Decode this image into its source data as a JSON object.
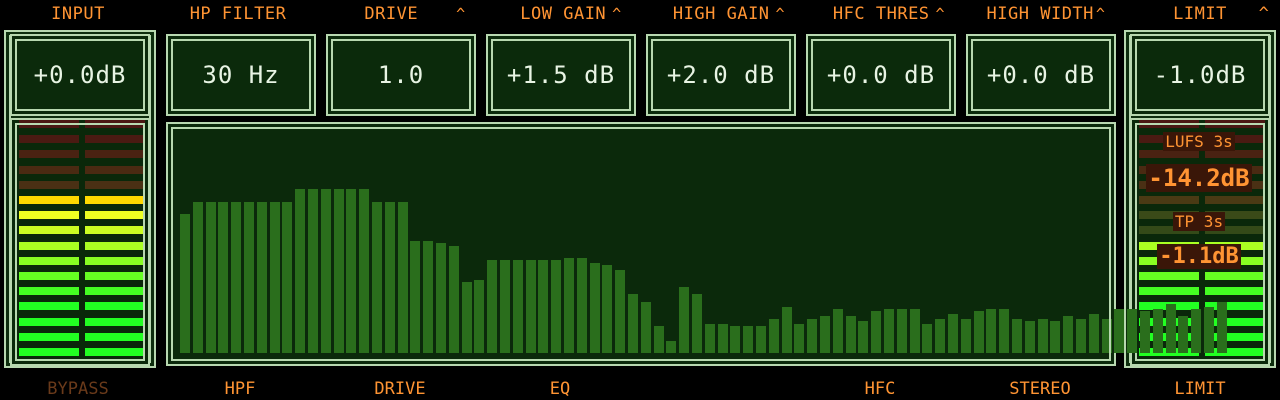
{
  "top_labels": {
    "input": "INPUT",
    "hp_filter": "HP FILTER",
    "drive": "DRIVE",
    "low_gain": "LOW GAIN",
    "high_gain": "HIGH GAIN",
    "hfc_thres": "HFC THRES",
    "high_width": "HIGH WIDTH",
    "limit": "LIMIT",
    "caret": "^"
  },
  "values": {
    "input": "+0.0dB",
    "hp_filter": "30 Hz",
    "drive": "1.0",
    "low_gain": "+1.5 dB",
    "high_gain": "+2.0 dB",
    "hfc_thres": "+0.0 dB",
    "high_width": "+0.0 dB",
    "limit": "-1.0dB"
  },
  "loudness": {
    "lufs_label": "LUFS 3s",
    "lufs_value": "-14.2dB",
    "tp_label": "TP 3s",
    "tp_value": "-1.1dB"
  },
  "bottom_labels": {
    "bypass": "BYPASS",
    "hpf": "HPF",
    "drive": "DRIVE",
    "eq": "EQ",
    "hfc": "HFC",
    "stereo": "STEREO",
    "limit": "LIMIT"
  },
  "colors": {
    "accent": "#ff9433",
    "panel_border": "#b8d8b0",
    "spectrum_bar": "#2a6e1c"
  },
  "meters": {
    "input_lit_segments": 11,
    "output_lit_segments": 8,
    "total_segments": 16
  },
  "spectrum": [
    0.57,
    0.62,
    0.62,
    0.62,
    0.62,
    0.62,
    0.62,
    0.62,
    0.62,
    0.67,
    0.67,
    0.67,
    0.67,
    0.67,
    0.67,
    0.62,
    0.62,
    0.62,
    0.46,
    0.46,
    0.45,
    0.44,
    0.29,
    0.3,
    0.38,
    0.38,
    0.38,
    0.38,
    0.38,
    0.38,
    0.39,
    0.39,
    0.37,
    0.36,
    0.34,
    0.24,
    0.21,
    0.11,
    0.05,
    0.27,
    0.24,
    0.12,
    0.12,
    0.11,
    0.11,
    0.11,
    0.14,
    0.19,
    0.12,
    0.14,
    0.15,
    0.18,
    0.15,
    0.13,
    0.17,
    0.18,
    0.18,
    0.18,
    0.12,
    0.14,
    0.16,
    0.14,
    0.17,
    0.18,
    0.18,
    0.14,
    0.13,
    0.14,
    0.13,
    0.15,
    0.14,
    0.16,
    0.14,
    0.18,
    0.18,
    0.17,
    0.18,
    0.2,
    0.15,
    0.18,
    0.19,
    0.21
  ]
}
